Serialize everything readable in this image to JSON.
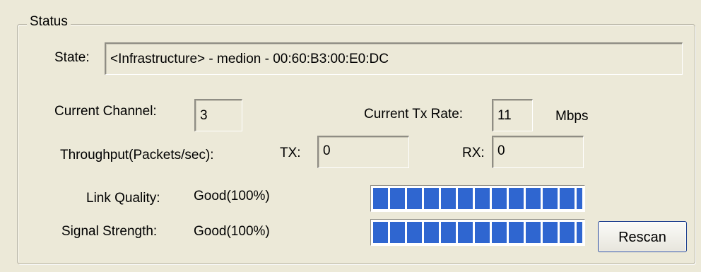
{
  "status_group": {
    "title": "Status",
    "state_label": "State:",
    "state_value": "<Infrastructure> - medion - 00:60:B3:00:E0:DC",
    "channel_label": "Current Channel:",
    "channel_value": "3",
    "tx_rate_label": "Current Tx Rate:",
    "tx_rate_value": "11",
    "tx_rate_unit": "Mbps",
    "throughput_label": "Throughput(Packets/sec):",
    "tx_label": "TX:",
    "tx_value": "0",
    "rx_label": "RX:",
    "rx_value": "0",
    "link_quality_label": "Link Quality:",
    "link_quality_value": "Good(100%)",
    "link_quality_percent": 100,
    "signal_strength_label": "Signal Strength:",
    "signal_strength_value": "Good(100%)",
    "signal_strength_percent": 100,
    "rescan_label": "Rescan"
  },
  "colors": {
    "background": "#ece9d8",
    "bar_fill": "#2f66d0"
  }
}
